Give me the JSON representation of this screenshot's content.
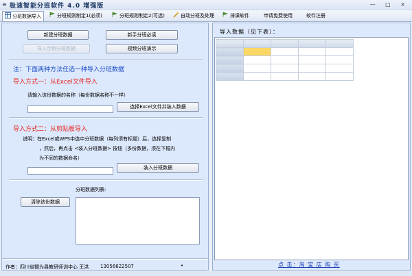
{
  "window": {
    "title": "极速智能分班软件 4.0 增强版",
    "controls": "— □ ×"
  },
  "tabs": [
    {
      "label": "分班数据导入",
      "active": true
    },
    {
      "label": "分班规则制定1(必须)",
      "active": false
    },
    {
      "label": "分班规则制定2(可选)",
      "active": false
    },
    {
      "label": "自动分班及处理",
      "active": false
    },
    {
      "label": "排课软件",
      "active": false
    },
    {
      "label": "申请免费使用",
      "active": false
    },
    {
      "label": "软件注册",
      "active": false
    }
  ],
  "left": {
    "btn_new": "新建分班数据",
    "btn_disabled": "导入示例分班数据",
    "btn_guide": "新手分班必读",
    "btn_video": "视频分班演示",
    "notice": "注：下面两种方法任选一种导入分班数据",
    "method1_title": "导入方式一：从Excel文件导入",
    "method1_prompt": "请输入该份数据的名称（每份数据名称不一样）",
    "method1_name_value": "",
    "method1_button": "选择Excel文件并装入数据",
    "method2_title": "导入方式二：从剪贴板导入",
    "method2_desc_line1": "说明：在Excel或WPS中选中分班数据（每列须有标题）后，选择复制",
    "method2_desc_line2": "，然后，再点击 <装入分班数据> 按钮（多份数据，须在下框内",
    "method2_desc_line3": "为不同的数据命名）",
    "method2_name_value": "",
    "method2_button": "装入分班数据",
    "list_label": "分班数据列表:",
    "btn_clear": "清除该份数据",
    "author": "作者：四川省犍为县教研师训中心 王洪",
    "phone": "13056622507",
    "dot": "•"
  },
  "right": {
    "title": "导入数据（见下表）：",
    "footer_link": "点 击：淘 宝 店 购 买"
  },
  "colors": {
    "notice": "#1f4fc8",
    "method_title": "#e8231e",
    "link": "#1a3fb5",
    "selected_cell": "#fbd765"
  }
}
